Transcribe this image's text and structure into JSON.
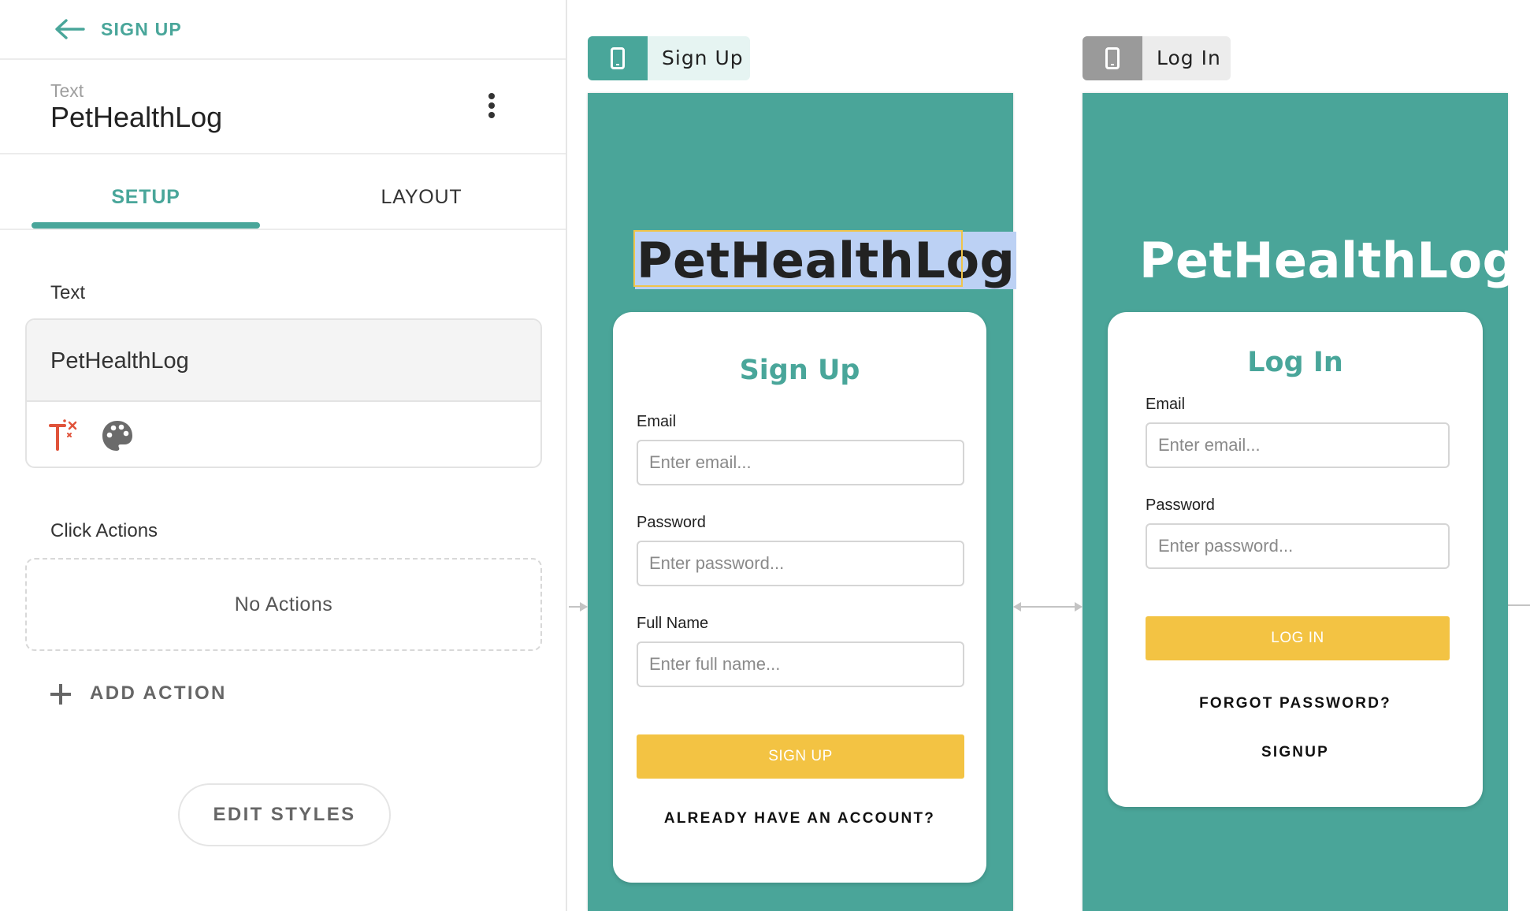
{
  "topbar": {
    "back_label": "SIGN UP"
  },
  "component": {
    "type": "Text",
    "name": "PetHealthLog"
  },
  "tabs": {
    "setup": "SETUP",
    "layout": "LAYOUT"
  },
  "setup": {
    "text_section_label": "Text",
    "text_value": "PetHealthLog",
    "click_actions_label": "Click Actions",
    "no_actions": "No Actions",
    "add_action": "ADD ACTION",
    "edit_styles": "EDIT STYLES"
  },
  "canvas": {
    "signup_tab": "Sign Up",
    "login_tab": "Log In",
    "signup_screen": {
      "app_title": "PetHealthLog",
      "card_title": "Sign Up",
      "email_label": "Email",
      "email_placeholder": "Enter email...",
      "password_label": "Password",
      "password_placeholder": "Enter password...",
      "fullname_label": "Full Name",
      "fullname_placeholder": "Enter full name...",
      "submit": "SIGN UP",
      "link": "ALREADY HAVE AN ACCOUNT?"
    },
    "login_screen": {
      "app_title": "PetHealthLog",
      "card_title": "Log In",
      "email_label": "Email",
      "email_placeholder": "Enter email...",
      "password_label": "Password",
      "password_placeholder": "Enter password...",
      "submit": "LOG IN",
      "forgot": "FORGOT PASSWORD?",
      "signup": "SIGNUP"
    }
  },
  "colors": {
    "accent": "#49a69a",
    "button": "#f3c343",
    "selection": "#bcd1f4",
    "selection_border": "#f0c44a"
  },
  "icons": [
    "back-arrow-icon",
    "more-vert-icon",
    "text-magic-icon",
    "palette-icon",
    "plus-icon",
    "phone-icon"
  ]
}
